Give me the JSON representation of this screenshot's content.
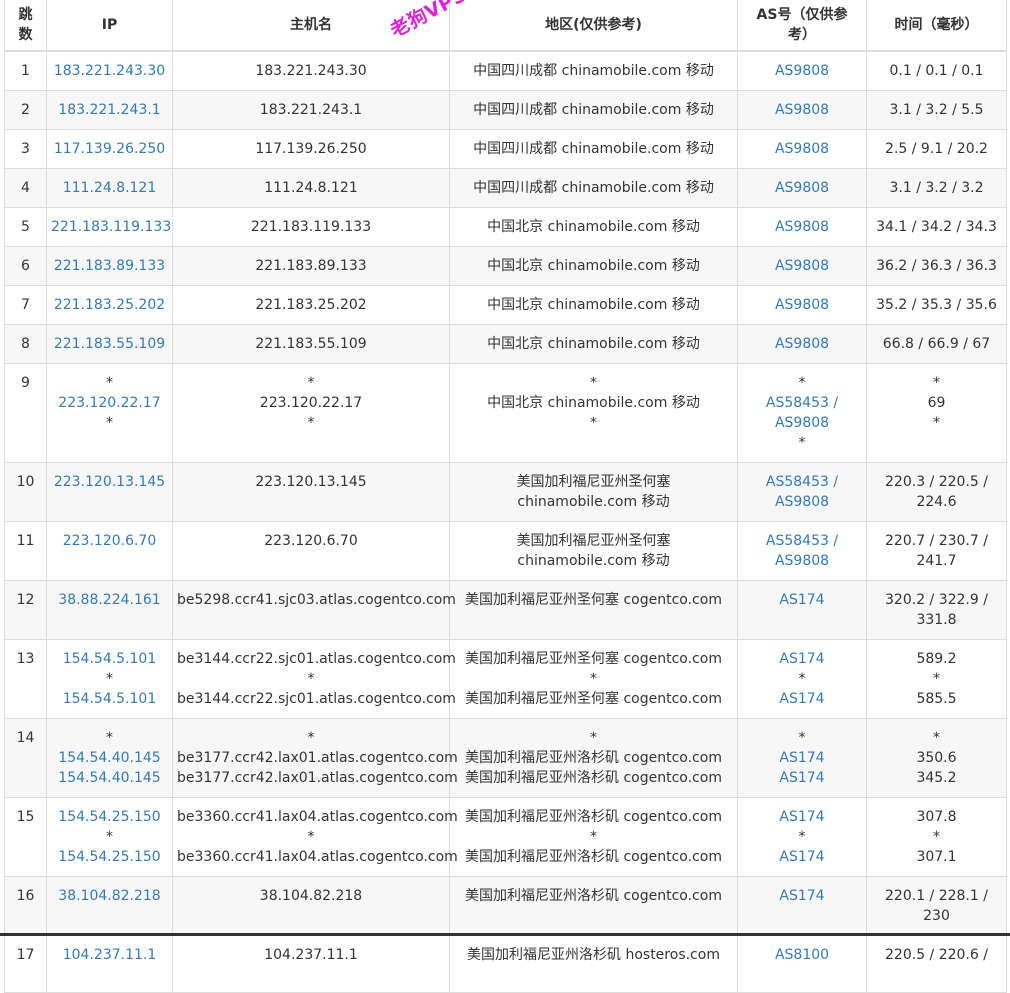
{
  "headers": {
    "hop": "跳数",
    "ip": "IP",
    "host": "主机名",
    "location": "地区(仅供参考)",
    "as": "AS号（仅供参考）",
    "time": "时间（毫秒）"
  },
  "watermark": "老狗VPS，跟加老狗！",
  "rows": [
    {
      "hop": "1",
      "size": 1,
      "ip": [
        "183.221.243.30"
      ],
      "host": [
        "183.221.243.30"
      ],
      "location": [
        "中国四川成都 chinamobile.com 移动"
      ],
      "as": [
        "AS9808"
      ],
      "time": [
        "0.1 / 0.1 / 0.1"
      ]
    },
    {
      "hop": "2",
      "size": 1,
      "ip": [
        "183.221.243.1"
      ],
      "host": [
        "183.221.243.1"
      ],
      "location": [
        "中国四川成都 chinamobile.com 移动"
      ],
      "as": [
        "AS9808"
      ],
      "time": [
        "3.1 / 3.2 / 5.5"
      ]
    },
    {
      "hop": "3",
      "size": 1,
      "ip": [
        "117.139.26.250"
      ],
      "host": [
        "117.139.26.250"
      ],
      "location": [
        "中国四川成都 chinamobile.com 移动"
      ],
      "as": [
        "AS9808"
      ],
      "time": [
        "2.5 / 9.1 / 20.2"
      ]
    },
    {
      "hop": "4",
      "size": 1,
      "ip": [
        "111.24.8.121"
      ],
      "host": [
        "111.24.8.121"
      ],
      "location": [
        "中国四川成都 chinamobile.com 移动"
      ],
      "as": [
        "AS9808"
      ],
      "time": [
        "3.1 / 3.2 / 3.2"
      ]
    },
    {
      "hop": "5",
      "size": 1,
      "ip": [
        "221.183.119.133"
      ],
      "host": [
        "221.183.119.133"
      ],
      "location": [
        "中国北京 chinamobile.com 移动"
      ],
      "as": [
        "AS9808"
      ],
      "time": [
        "34.1 / 34.2 / 34.3"
      ]
    },
    {
      "hop": "6",
      "size": 1,
      "ip": [
        "221.183.89.133"
      ],
      "host": [
        "221.183.89.133"
      ],
      "location": [
        "中国北京 chinamobile.com 移动"
      ],
      "as": [
        "AS9808"
      ],
      "time": [
        "36.2 / 36.3 / 36.3"
      ]
    },
    {
      "hop": "7",
      "size": 1,
      "ip": [
        "221.183.25.202"
      ],
      "host": [
        "221.183.25.202"
      ],
      "location": [
        "中国北京 chinamobile.com 移动"
      ],
      "as": [
        "AS9808"
      ],
      "time": [
        "35.2 / 35.3 / 35.6"
      ]
    },
    {
      "hop": "8",
      "size": 1,
      "ip": [
        "221.183.55.109"
      ],
      "host": [
        "221.183.55.109"
      ],
      "location": [
        "中国北京 chinamobile.com 移动"
      ],
      "as": [
        "AS9808"
      ],
      "time": [
        "66.8 / 66.9 / 67"
      ]
    },
    {
      "hop": "9",
      "size": 4,
      "ip": [
        "*",
        "223.120.22.17",
        "*"
      ],
      "host": [
        "*",
        "223.120.22.17",
        "*"
      ],
      "location": [
        "*",
        "中国北京 chinamobile.com 移动",
        "*"
      ],
      "as": [
        "*",
        "AS58453 /",
        "AS9808",
        "*"
      ],
      "time": [
        "*",
        "69",
        "*"
      ]
    },
    {
      "hop": "10",
      "size": 2,
      "ip": [
        "223.120.13.145"
      ],
      "host": [
        "223.120.13.145"
      ],
      "location": [
        "美国加利福尼亚州圣何塞",
        "chinamobile.com 移动"
      ],
      "as": [
        "AS58453 /",
        "AS9808"
      ],
      "time": [
        "220.3 / 220.5 /",
        "224.6"
      ]
    },
    {
      "hop": "11",
      "size": 2,
      "ip": [
        "223.120.6.70"
      ],
      "host": [
        "223.120.6.70"
      ],
      "location": [
        "美国加利福尼亚州圣何塞",
        "chinamobile.com 移动"
      ],
      "as": [
        "AS58453 /",
        "AS9808"
      ],
      "time": [
        "220.7 / 230.7 /",
        "241.7"
      ]
    },
    {
      "hop": "12",
      "size": 2,
      "ip": [
        "38.88.224.161"
      ],
      "host": [
        "be5298.ccr41.sjc03.atlas.cogentco.com"
      ],
      "location": [
        "美国加利福尼亚州圣何塞 cogentco.com"
      ],
      "as": [
        "AS174"
      ],
      "time": [
        "320.2 / 322.9 /",
        "331.8"
      ]
    },
    {
      "hop": "13",
      "size": 3,
      "ip": [
        "154.54.5.101",
        "*",
        "154.54.5.101"
      ],
      "host": [
        "be3144.ccr22.sjc01.atlas.cogentco.com",
        "*",
        "be3144.ccr22.sjc01.atlas.cogentco.com"
      ],
      "location": [
        "美国加利福尼亚州圣何塞 cogentco.com",
        "*",
        "美国加利福尼亚州圣何塞 cogentco.com"
      ],
      "as": [
        "AS174",
        "*",
        "AS174"
      ],
      "time": [
        "589.2",
        "*",
        "585.5"
      ]
    },
    {
      "hop": "14",
      "size": 3,
      "ip": [
        "*",
        "154.54.40.145",
        "154.54.40.145"
      ],
      "host": [
        "*",
        "be3177.ccr42.lax01.atlas.cogentco.com",
        "be3177.ccr42.lax01.atlas.cogentco.com"
      ],
      "location": [
        "*",
        "美国加利福尼亚州洛杉矶 cogentco.com",
        "美国加利福尼亚州洛杉矶 cogentco.com"
      ],
      "as": [
        "*",
        "AS174",
        "AS174"
      ],
      "time": [
        "*",
        "350.6",
        "345.2"
      ]
    },
    {
      "hop": "15",
      "size": 3,
      "ip": [
        "154.54.25.150",
        "*",
        "154.54.25.150"
      ],
      "host": [
        "be3360.ccr41.lax04.atlas.cogentco.com",
        "*",
        "be3360.ccr41.lax04.atlas.cogentco.com"
      ],
      "location": [
        "美国加利福尼亚州洛杉矶 cogentco.com",
        "*",
        "美国加利福尼亚州洛杉矶 cogentco.com"
      ],
      "as": [
        "AS174",
        "*",
        "AS174"
      ],
      "time": [
        "307.8",
        "*",
        "307.1"
      ]
    },
    {
      "hop": "16",
      "size": 2,
      "ip": [
        "38.104.82.218"
      ],
      "host": [
        "38.104.82.218"
      ],
      "location": [
        "美国加利福尼亚州洛杉矶 cogentco.com"
      ],
      "as": [
        "AS174"
      ],
      "time": [
        "220.1 / 228.1 /",
        "230"
      ]
    },
    {
      "hop": "17",
      "size": 2,
      "ip": [
        "104.237.11.1"
      ],
      "host": [
        "104.237.11.1"
      ],
      "location": [
        "美国加利福尼亚州洛杉矶 hosteros.com"
      ],
      "as": [
        "AS8100"
      ],
      "time": [
        "220.5 / 220.6 /",
        ""
      ]
    }
  ]
}
